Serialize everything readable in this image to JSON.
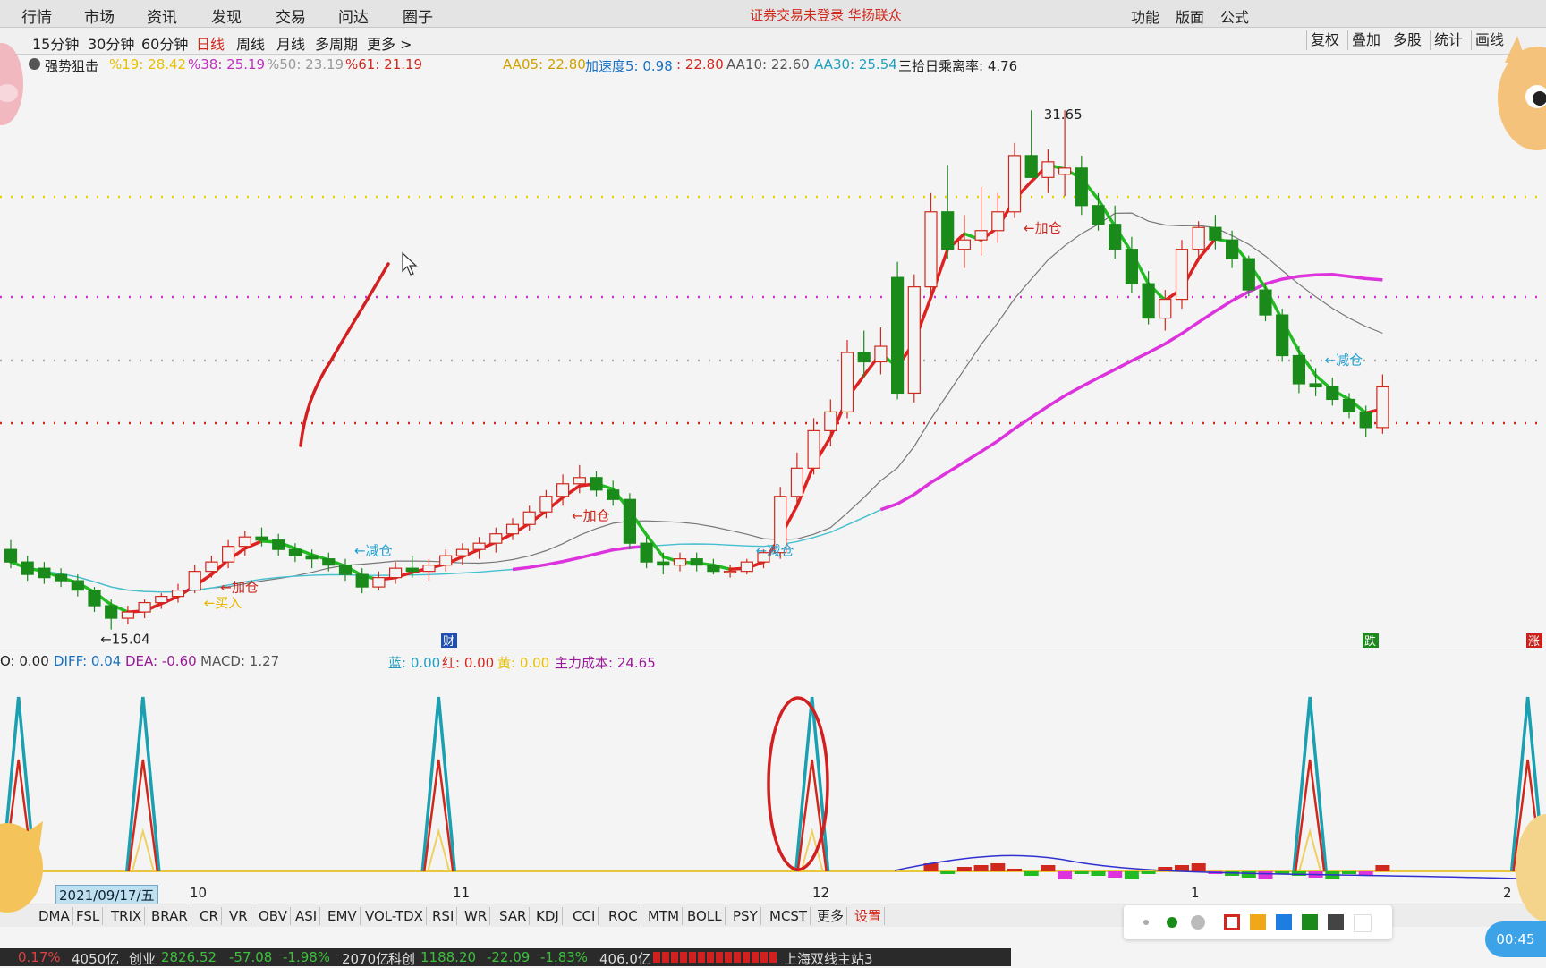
{
  "menu": {
    "items": [
      "行情",
      "市场",
      "资讯",
      "发现",
      "交易",
      "问达",
      "圈子"
    ],
    "notice": "证券交易未登录 华扬联众",
    "right_items": [
      "功能",
      "版面",
      "公式"
    ]
  },
  "toolbar": {
    "periods": [
      "15分钟",
      "30分钟",
      "60分钟",
      "日线",
      "周线",
      "月线",
      "多周期",
      "更多 >"
    ],
    "active_period": "日线",
    "right_buttons": [
      "复权",
      "叠加",
      "多股",
      "统计",
      "画线"
    ]
  },
  "info_bar": {
    "indicator_name": "强势狙击",
    "fib19": "%19: 28.42",
    "fib38": "%38: 25.19",
    "fib50": "%50: 23.19",
    "fib61": "%61: 21.19",
    "aa05": "AA05: 22.80",
    "accel": "加速度5: 0.98",
    "accel2": ": 22.80",
    "aa10": "AA10: 22.60",
    "aa30": "AA30: 25.54",
    "deviation": "三拾日乘离率: 4.76"
  },
  "main_chart": {
    "high_label": "31.65",
    "low_label": "←15.04",
    "signals": [
      {
        "text": "←买入",
        "color": "#e8b800",
        "bar": 11
      },
      {
        "text": "←加仓",
        "color": "#d0281c",
        "bar": 12
      },
      {
        "text": "←减仓",
        "color": "#20a0d0",
        "bar": 20
      },
      {
        "text": "←加仓",
        "color": "#d0281c",
        "bar": 33
      },
      {
        "text": "←减仓",
        "color": "#20a0d0",
        "bar": 44
      },
      {
        "text": "←加仓",
        "color": "#d0281c",
        "bar": 60
      },
      {
        "text": "←减仓",
        "color": "#20a0d0",
        "bar": 78
      }
    ],
    "markers": {
      "cai": "财",
      "die": "跌",
      "zhang": "涨"
    }
  },
  "indicator_info": {
    "first": "O: 0.00",
    "diff": "DIFF: 0.04",
    "dea": "DEA: -0.60",
    "macd": "MACD: 1.27",
    "blue": "蓝: 0.00",
    "red": "红: 0.00",
    "yellow": "黄: 0.00",
    "cost": "主力成本: 24.65"
  },
  "date_axis": {
    "current": "2021/09/17/五",
    "months": [
      "10",
      "11",
      "12",
      "1",
      "2"
    ]
  },
  "tabs": [
    "DMA",
    "FSL",
    "TRIX",
    "BRAR",
    "CR",
    "VR",
    "OBV",
    "ASI",
    "EMV",
    "VOL-TDX",
    "RSI",
    "WR",
    "SAR",
    "KDJ",
    "CCI",
    "ROC",
    "MTM",
    "BOLL",
    "PSY",
    "MCST",
    "更多",
    "设置"
  ],
  "status_bar": {
    "sh_pct": "0.17%",
    "sh_amount": "4050亿",
    "cy_label": "创业",
    "cy_value": "2826.52",
    "cy_change": "-57.08",
    "cy_pct": "-1.98%",
    "cy_amount": "2070亿",
    "kc_label": "科创",
    "kc_value": "1188.20",
    "kc_change": "-22.09",
    "kc_pct": "-1.83%",
    "kc_amount": "406.0亿",
    "server": "上海双线主站3"
  },
  "timer": "00:45",
  "colors": {
    "up": "#d0281c",
    "down": "#1a8a1a",
    "ma_green": "#22bb22",
    "ma_red": "#dd2222",
    "ma_orange": "#d09010",
    "ma_magenta": "#dd33dd",
    "ma_cyan": "#44c0d0",
    "ma_gray": "#777777"
  },
  "chart_data": {
    "type": "candlestick",
    "ohlc": [
      [
        17.6,
        17.9,
        17.0,
        17.2
      ],
      [
        17.2,
        17.4,
        16.6,
        16.8
      ],
      [
        17.0,
        17.2,
        16.5,
        16.7
      ],
      [
        16.8,
        17.0,
        16.4,
        16.6
      ],
      [
        16.6,
        16.8,
        16.1,
        16.3
      ],
      [
        16.3,
        16.4,
        15.6,
        15.8
      ],
      [
        15.8,
        16.0,
        15.04,
        15.4
      ],
      [
        15.4,
        15.8,
        15.2,
        15.6
      ],
      [
        15.6,
        16.0,
        15.4,
        15.9
      ],
      [
        15.9,
        16.2,
        15.7,
        16.1
      ],
      [
        16.1,
        16.5,
        15.9,
        16.3
      ],
      [
        16.3,
        17.1,
        16.2,
        16.9
      ],
      [
        16.9,
        17.4,
        16.7,
        17.2
      ],
      [
        17.2,
        17.9,
        17.0,
        17.7
      ],
      [
        17.7,
        18.2,
        17.4,
        18.0
      ],
      [
        18.0,
        18.3,
        17.7,
        17.9
      ],
      [
        17.9,
        18.1,
        17.4,
        17.6
      ],
      [
        17.6,
        17.8,
        17.2,
        17.4
      ],
      [
        17.4,
        17.6,
        17.0,
        17.3
      ],
      [
        17.3,
        17.5,
        16.9,
        17.1
      ],
      [
        17.1,
        17.3,
        16.6,
        16.8
      ],
      [
        16.8,
        17.0,
        16.2,
        16.4
      ],
      [
        16.4,
        16.9,
        16.3,
        16.7
      ],
      [
        16.7,
        17.2,
        16.5,
        17.0
      ],
      [
        17.0,
        17.4,
        16.7,
        16.9
      ],
      [
        16.9,
        17.3,
        16.6,
        17.1
      ],
      [
        17.1,
        17.6,
        16.9,
        17.4
      ],
      [
        17.4,
        17.8,
        17.1,
        17.6
      ],
      [
        17.6,
        18.0,
        17.3,
        17.8
      ],
      [
        17.8,
        18.3,
        17.5,
        18.1
      ],
      [
        18.1,
        18.6,
        17.9,
        18.4
      ],
      [
        18.4,
        19.0,
        18.2,
        18.8
      ],
      [
        18.8,
        19.5,
        18.6,
        19.3
      ],
      [
        19.3,
        20.0,
        19.0,
        19.7
      ],
      [
        19.7,
        20.3,
        19.4,
        19.9
      ],
      [
        19.9,
        20.1,
        19.3,
        19.5
      ],
      [
        19.5,
        19.8,
        19.0,
        19.2
      ],
      [
        19.2,
        19.4,
        17.6,
        17.8
      ],
      [
        17.8,
        18.0,
        17.0,
        17.2
      ],
      [
        17.2,
        17.5,
        16.8,
        17.1
      ],
      [
        17.1,
        17.5,
        16.9,
        17.3
      ],
      [
        17.3,
        17.5,
        16.9,
        17.1
      ],
      [
        17.1,
        17.3,
        16.8,
        16.9
      ],
      [
        16.9,
        17.1,
        16.7,
        16.9
      ],
      [
        16.9,
        17.3,
        16.8,
        17.2
      ],
      [
        17.2,
        17.6,
        17.0,
        17.5
      ],
      [
        17.5,
        19.6,
        17.3,
        19.3
      ],
      [
        19.3,
        20.7,
        19.0,
        20.2
      ],
      [
        20.2,
        21.8,
        20.0,
        21.4
      ],
      [
        21.4,
        22.4,
        20.9,
        22.0
      ],
      [
        22.0,
        24.3,
        21.8,
        23.9
      ],
      [
        23.9,
        24.6,
        23.1,
        23.6
      ],
      [
        23.6,
        24.7,
        23.2,
        24.1
      ],
      [
        26.3,
        26.8,
        22.4,
        22.6
      ],
      [
        22.6,
        26.4,
        22.3,
        26.0
      ],
      [
        26.0,
        29.0,
        25.6,
        28.4
      ],
      [
        28.4,
        29.9,
        26.9,
        27.2
      ],
      [
        27.2,
        28.3,
        26.6,
        27.5
      ],
      [
        27.5,
        29.2,
        27.0,
        27.8
      ],
      [
        27.8,
        29.0,
        27.4,
        28.4
      ],
      [
        28.4,
        30.6,
        28.2,
        30.2
      ],
      [
        30.2,
        31.65,
        29.8,
        29.5
      ],
      [
        29.5,
        30.4,
        29.0,
        30.0
      ],
      [
        29.6,
        31.65,
        28.9,
        29.8
      ],
      [
        29.8,
        30.2,
        28.3,
        28.6
      ],
      [
        28.6,
        29.0,
        27.8,
        28.0
      ],
      [
        28.0,
        28.6,
        26.9,
        27.2
      ],
      [
        27.2,
        27.6,
        25.8,
        26.1
      ],
      [
        26.1,
        26.5,
        24.8,
        25.0
      ],
      [
        25.0,
        25.9,
        24.6,
        25.6
      ],
      [
        25.6,
        27.5,
        25.3,
        27.2
      ],
      [
        27.2,
        28.1,
        26.8,
        27.9
      ],
      [
        27.9,
        28.3,
        27.2,
        27.5
      ],
      [
        27.5,
        27.8,
        26.6,
        26.9
      ],
      [
        26.9,
        27.0,
        25.7,
        25.9
      ],
      [
        25.9,
        26.1,
        24.9,
        25.1
      ],
      [
        25.1,
        25.3,
        23.6,
        23.8
      ],
      [
        23.8,
        24.1,
        22.6,
        22.9
      ],
      [
        22.9,
        23.4,
        22.5,
        22.8
      ],
      [
        22.8,
        23.1,
        22.2,
        22.4
      ],
      [
        22.4,
        22.6,
        21.8,
        22.0
      ],
      [
        22.0,
        22.2,
        21.2,
        21.5
      ],
      [
        21.5,
        23.2,
        21.3,
        22.8
      ]
    ],
    "spikes": [
      0.5,
      8.5,
      27.5,
      51.5,
      83.5,
      97.5
    ],
    "ylim": [
      14.4,
      32.8
    ]
  }
}
